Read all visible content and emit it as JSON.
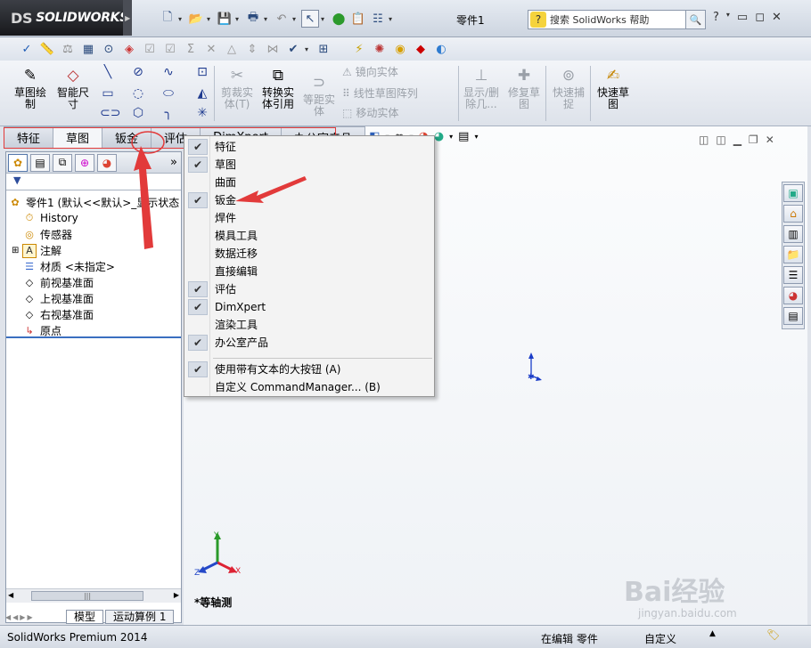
{
  "app": {
    "logo_ds": "DS",
    "logo_text": "SOLIDWORKS",
    "document_title": "零件1",
    "search_placeholder": "搜索 SolidWorks 帮助"
  },
  "command_manager": {
    "buttons": [
      {
        "label": "草图绘\n制",
        "enabled": true
      },
      {
        "label": "智能尺\n寸",
        "enabled": true
      },
      {
        "label": "剪裁实\n体(T)",
        "enabled": false
      },
      {
        "label": "转换实\n体引用",
        "enabled": true
      },
      {
        "label": "等距实\n体",
        "enabled": false
      },
      {
        "label": "显示/删\n除几...",
        "enabled": false
      },
      {
        "label": "修复草\n图",
        "enabled": false
      },
      {
        "label": "快速捕\n捉",
        "enabled": false
      },
      {
        "label": "快速草\n图",
        "enabled": true
      }
    ],
    "small": [
      {
        "label": "镜向实体",
        "enabled": false
      },
      {
        "label": "线性草图阵列",
        "enabled": false
      },
      {
        "label": "移动实体",
        "enabled": false
      }
    ],
    "tabs": [
      "特征",
      "草图",
      "钣金",
      "评估",
      "DimXpert",
      "办公室产品"
    ]
  },
  "feature_tree": {
    "items": [
      {
        "label": "零件1 (默认<<默认>_显示状态",
        "icon": "part-icon"
      },
      {
        "label": "History",
        "icon": "history-icon"
      },
      {
        "label": "传感器",
        "icon": "sensor-icon"
      },
      {
        "label": "注解",
        "icon": "annotation-icon"
      },
      {
        "label": "材质 <未指定>",
        "icon": "material-icon"
      },
      {
        "label": "前视基准面",
        "icon": "plane-icon"
      },
      {
        "label": "上视基准面",
        "icon": "plane-icon"
      },
      {
        "label": "右视基准面",
        "icon": "plane-icon"
      },
      {
        "label": "原点",
        "icon": "origin-icon"
      }
    ],
    "bottom_tabs": [
      "模型",
      "运动算例 1"
    ],
    "scroll_thumb": "|||"
  },
  "context_menu": {
    "items": [
      {
        "label": "特征",
        "checked": true
      },
      {
        "label": "草图",
        "checked": true
      },
      {
        "label": "曲面",
        "checked": false
      },
      {
        "label": "钣金",
        "checked": true
      },
      {
        "label": "焊件",
        "checked": false
      },
      {
        "label": "模具工具",
        "checked": false
      },
      {
        "label": "数据迁移",
        "checked": false
      },
      {
        "label": "直接编辑",
        "checked": false
      },
      {
        "label": "评估",
        "checked": true
      },
      {
        "label": "DimXpert",
        "checked": true
      },
      {
        "label": "渲染工具",
        "checked": false
      },
      {
        "label": "办公室产品",
        "checked": true
      }
    ],
    "footer_items": [
      {
        "label": "使用带有文本的大按钮 (A)",
        "checked": true
      },
      {
        "label": "自定义 CommandManager... (B)",
        "checked": false
      }
    ]
  },
  "viewport": {
    "view_name": "*等轴测",
    "triad_x": "X",
    "triad_y": "Y",
    "triad_z": "Z"
  },
  "status_bar": {
    "product": "SolidWorks Premium 2014",
    "state": "在编辑 零件",
    "custom": "自定义"
  },
  "watermark": {
    "main": "Bai经验",
    "sub": "jingyan.baidu.com"
  },
  "colors": {
    "accent": "#3a6fc0",
    "annotation": "#e23a3a"
  }
}
